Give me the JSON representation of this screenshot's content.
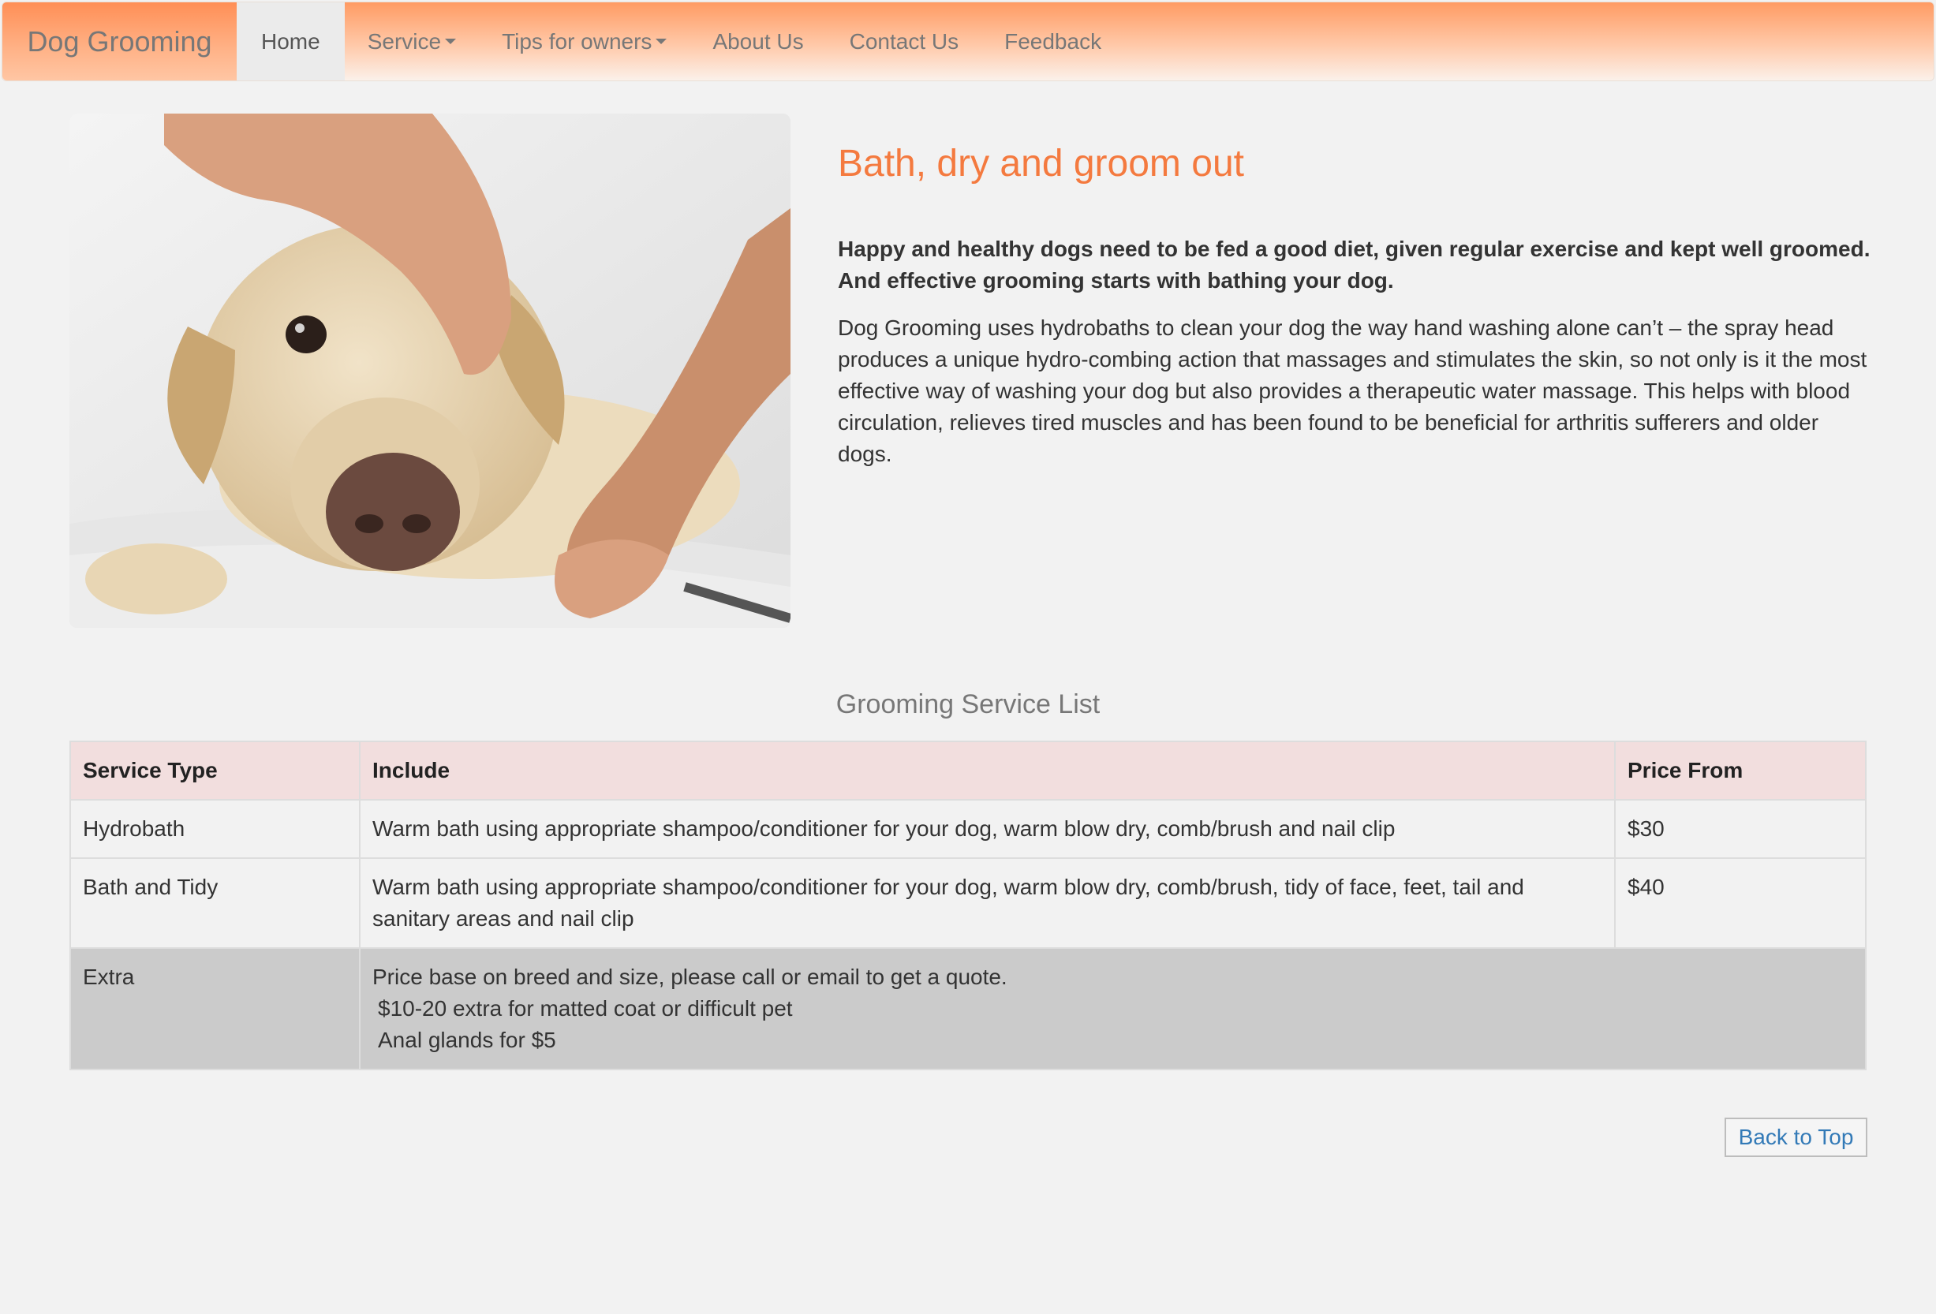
{
  "navbar": {
    "brand": "Dog Grooming",
    "items": [
      {
        "label": "Home",
        "active": true,
        "dropdown": false
      },
      {
        "label": "Service",
        "active": false,
        "dropdown": true
      },
      {
        "label": "Tips for owners",
        "active": false,
        "dropdown": true
      },
      {
        "label": "About Us",
        "active": false,
        "dropdown": false
      },
      {
        "label": "Contact Us",
        "active": false,
        "dropdown": false
      },
      {
        "label": "Feedback",
        "active": false,
        "dropdown": false
      }
    ]
  },
  "hero": {
    "title": "Bath, dry and groom out",
    "lead": "Happy and healthy dogs need to be fed a good diet, given regular exercise and kept well groomed. And effective grooming starts with bathing your dog.",
    "body": "Dog Grooming uses hydrobaths to clean your dog the way hand washing alone can’t – the spray head produces a unique hydro-combing action that massages and stimulates the skin, so not only is it the most effective way of washing your dog but also provides a therapeutic water massage. This helps with blood circulation, relieves tired muscles and has been found to be beneficial for arthritis sufferers and older dogs."
  },
  "services": {
    "caption": "Grooming Service List",
    "headers": [
      "Service Type",
      "Include",
      "Price From"
    ],
    "rows": [
      {
        "type": "Hydrobath",
        "include": "Warm bath using appropriate shampoo/conditioner for your dog, warm blow dry, comb/brush and nail clip",
        "price": "$30"
      },
      {
        "type": "Bath and Tidy",
        "include": "Warm bath using appropriate shampoo/conditioner for your dog, warm blow dry, comb/brush, tidy of face, feet, tail and sanitary areas and nail clip",
        "price": "$40"
      }
    ],
    "extra": {
      "type": "Extra",
      "lines": [
        "Price base on breed and size, please call or email to get a quote.",
        "$10-20 extra for matted coat or difficult pet",
        "Anal glands for $5"
      ]
    }
  },
  "footer": {
    "back_to_top": "Back to Top"
  },
  "colors": {
    "accent": "#f47a3f",
    "nav_gradient_top": "#ff9b63",
    "table_header": "#f2dede",
    "extra_row": "#cbcbcb",
    "link": "#337ab7"
  }
}
